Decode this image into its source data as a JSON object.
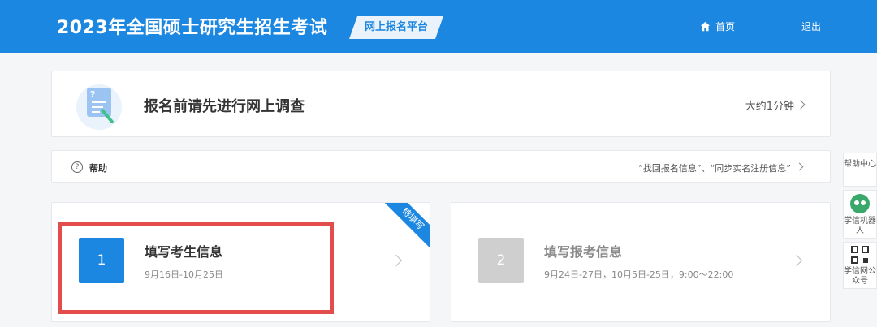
{
  "header": {
    "title": "2023年全国硕士研究生招生考试",
    "platform_tag": "网上报名平台",
    "home_label": "首页",
    "logout_label": "退出"
  },
  "survey": {
    "title": "报名前请先进行网上调查",
    "duration": "大约1分钟"
  },
  "help_bar": {
    "label": "帮助",
    "links": "“找回报名信息”、“同步实名注册信息”"
  },
  "steps": [
    {
      "number": "1",
      "title": "填写考生信息",
      "time": "9月16日-10月25日",
      "ribbon": "待填写"
    },
    {
      "number": "2",
      "title": "填写报考信息",
      "time": "9月24日-27日，10月5日-25日，9:00～22:00"
    }
  ],
  "sidebar": {
    "help_center": "帮助中心",
    "bot": "学信机器人",
    "wechat": "学信网公众号"
  },
  "colors": {
    "primary": "#1c87e0",
    "highlight": "#e44c4c",
    "disabled": "#cfcfcf"
  }
}
